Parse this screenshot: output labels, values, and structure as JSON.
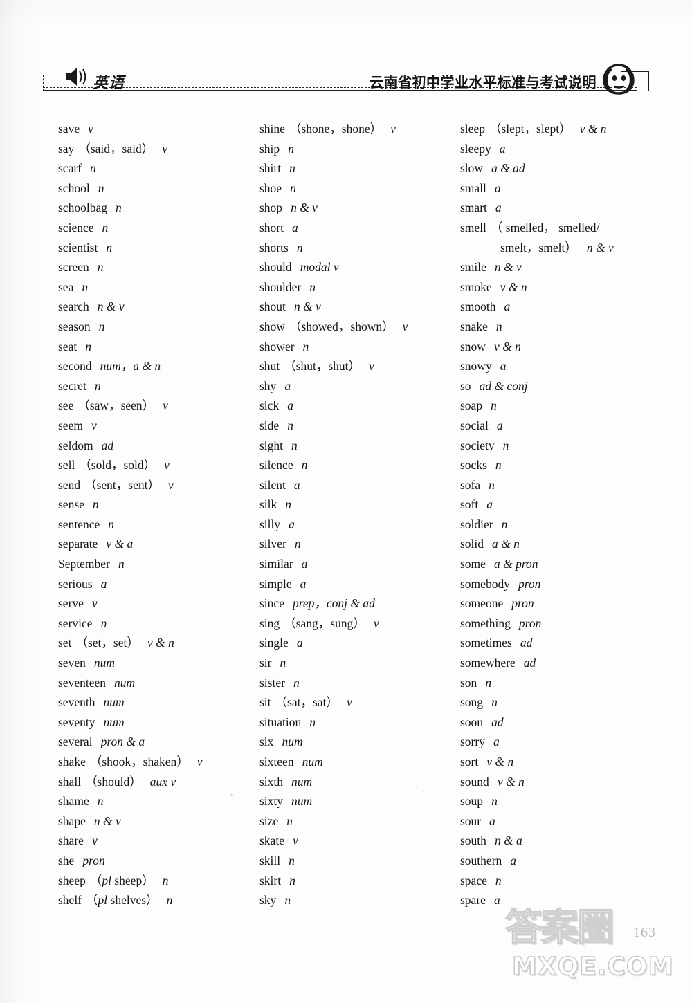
{
  "header": {
    "subject_label": "英语",
    "book_title": "云南省初中学业水平标准与考试说明",
    "speaker_icon": "speaker-icon",
    "headphone_icon": "headphone-face-icon"
  },
  "footer": {
    "page_number": "163",
    "watermark_cn": "答案圈",
    "watermark_en": "MXQE.COM"
  },
  "columns": [
    {
      "id": "column-1",
      "entries": [
        {
          "word": "save",
          "forms": "",
          "pos": "v"
        },
        {
          "word": "say",
          "forms": "（said，said）",
          "pos": "v"
        },
        {
          "word": "scarf",
          "forms": "",
          "pos": "n"
        },
        {
          "word": "school",
          "forms": "",
          "pos": "n"
        },
        {
          "word": "schoolbag",
          "forms": "",
          "pos": "n"
        },
        {
          "word": "science",
          "forms": "",
          "pos": "n"
        },
        {
          "word": "scientist",
          "forms": "",
          "pos": "n"
        },
        {
          "word": "screen",
          "forms": "",
          "pos": "n"
        },
        {
          "word": "sea",
          "forms": "",
          "pos": "n"
        },
        {
          "word": "search",
          "forms": "",
          "pos": "n & v"
        },
        {
          "word": "season",
          "forms": "",
          "pos": "n"
        },
        {
          "word": "seat",
          "forms": "",
          "pos": "n"
        },
        {
          "word": "second",
          "forms": "",
          "pos": "num，a & n"
        },
        {
          "word": "secret",
          "forms": "",
          "pos": "n"
        },
        {
          "word": "see",
          "forms": "（saw，seen）",
          "pos": "v"
        },
        {
          "word": "seem",
          "forms": "",
          "pos": "v"
        },
        {
          "word": "seldom",
          "forms": "",
          "pos": "ad"
        },
        {
          "word": "sell",
          "forms": "（sold，sold）",
          "pos": "v"
        },
        {
          "word": "send",
          "forms": "（sent，sent）",
          "pos": "v"
        },
        {
          "word": "sense",
          "forms": "",
          "pos": "n"
        },
        {
          "word": "sentence",
          "forms": "",
          "pos": "n"
        },
        {
          "word": "separate",
          "forms": "",
          "pos": "v & a"
        },
        {
          "word": "September",
          "forms": "",
          "pos": "n"
        },
        {
          "word": "serious",
          "forms": "",
          "pos": "a"
        },
        {
          "word": "serve",
          "forms": "",
          "pos": "v"
        },
        {
          "word": "service",
          "forms": "",
          "pos": "n"
        },
        {
          "word": "set",
          "forms": "（set，set）",
          "pos": "v & n"
        },
        {
          "word": "seven",
          "forms": "",
          "pos": "num"
        },
        {
          "word": "seventeen",
          "forms": "",
          "pos": "num"
        },
        {
          "word": "seventh",
          "forms": "",
          "pos": "num"
        },
        {
          "word": "seventy",
          "forms": "",
          "pos": "num"
        },
        {
          "word": "several",
          "forms": "",
          "pos": "pron & a"
        },
        {
          "word": "shake",
          "forms": "（shook，shaken）",
          "pos": "v"
        },
        {
          "word": "shall",
          "forms": "（should）",
          "pos": "aux v"
        },
        {
          "word": "shame",
          "forms": "",
          "pos": "n"
        },
        {
          "word": "shape",
          "forms": "",
          "pos": "n & v"
        },
        {
          "word": "share",
          "forms": "",
          "pos": "v"
        },
        {
          "word": "she",
          "forms": "",
          "pos": "pron"
        },
        {
          "word": "sheep",
          "forms": "（pl sheep）",
          "pos": "n",
          "forms_italic_lead": "pl"
        },
        {
          "word": "shelf",
          "forms": "（pl shelves）",
          "pos": "n",
          "forms_italic_lead": "pl"
        }
      ]
    },
    {
      "id": "column-2",
      "entries": [
        {
          "word": "shine",
          "forms": "（shone，shone）",
          "pos": "v"
        },
        {
          "word": "ship",
          "forms": "",
          "pos": "n"
        },
        {
          "word": "shirt",
          "forms": "",
          "pos": "n"
        },
        {
          "word": "shoe",
          "forms": "",
          "pos": "n"
        },
        {
          "word": "shop",
          "forms": "",
          "pos": "n & v"
        },
        {
          "word": "short",
          "forms": "",
          "pos": "a"
        },
        {
          "word": "shorts",
          "forms": "",
          "pos": "n"
        },
        {
          "word": "should",
          "forms": "",
          "pos": "modal v"
        },
        {
          "word": "shoulder",
          "forms": "",
          "pos": "n"
        },
        {
          "word": "shout",
          "forms": "",
          "pos": "n & v"
        },
        {
          "word": "show",
          "forms": "（showed，shown）",
          "pos": "v"
        },
        {
          "word": "shower",
          "forms": "",
          "pos": "n"
        },
        {
          "word": "shut",
          "forms": "（shut，shut）",
          "pos": "v"
        },
        {
          "word": "shy",
          "forms": "",
          "pos": "a"
        },
        {
          "word": "sick",
          "forms": "",
          "pos": "a"
        },
        {
          "word": "side",
          "forms": "",
          "pos": "n"
        },
        {
          "word": "sight",
          "forms": "",
          "pos": "n"
        },
        {
          "word": "silence",
          "forms": "",
          "pos": "n"
        },
        {
          "word": "silent",
          "forms": "",
          "pos": "a"
        },
        {
          "word": "silk",
          "forms": "",
          "pos": "n"
        },
        {
          "word": "silly",
          "forms": "",
          "pos": "a"
        },
        {
          "word": "silver",
          "forms": "",
          "pos": "n"
        },
        {
          "word": "similar",
          "forms": "",
          "pos": "a"
        },
        {
          "word": "simple",
          "forms": "",
          "pos": "a"
        },
        {
          "word": "since",
          "forms": "",
          "pos": "prep，conj & ad"
        },
        {
          "word": "sing",
          "forms": "（sang，sung）",
          "pos": "v"
        },
        {
          "word": "single",
          "forms": "",
          "pos": "a"
        },
        {
          "word": "sir",
          "forms": "",
          "pos": "n"
        },
        {
          "word": "sister",
          "forms": "",
          "pos": "n"
        },
        {
          "word": "sit",
          "forms": "（sat，sat）",
          "pos": "v"
        },
        {
          "word": "situation",
          "forms": "",
          "pos": "n"
        },
        {
          "word": "six",
          "forms": "",
          "pos": "num"
        },
        {
          "word": "sixteen",
          "forms": "",
          "pos": "num"
        },
        {
          "word": "sixth",
          "forms": "",
          "pos": "num"
        },
        {
          "word": "sixty",
          "forms": "",
          "pos": "num"
        },
        {
          "word": "size",
          "forms": "",
          "pos": "n"
        },
        {
          "word": "skate",
          "forms": "",
          "pos": "v"
        },
        {
          "word": "skill",
          "forms": "",
          "pos": "n"
        },
        {
          "word": "skirt",
          "forms": "",
          "pos": "n"
        },
        {
          "word": "sky",
          "forms": "",
          "pos": "n"
        }
      ]
    },
    {
      "id": "column-3",
      "entries": [
        {
          "word": "sleep",
          "forms": "（slept，slept）",
          "pos": "v & n"
        },
        {
          "word": "sleepy",
          "forms": "",
          "pos": "a"
        },
        {
          "word": "slow",
          "forms": "",
          "pos": "a & ad"
        },
        {
          "word": "small",
          "forms": "",
          "pos": "a"
        },
        {
          "word": "smart",
          "forms": "",
          "pos": "a"
        },
        {
          "word": "smell",
          "forms": "（ smelled， smelled/",
          "pos": "",
          "line2_forms": "smelt，smelt）",
          "line2_pos": "n & v"
        },
        {
          "word": "smile",
          "forms": "",
          "pos": "n & v"
        },
        {
          "word": "smoke",
          "forms": "",
          "pos": "v & n"
        },
        {
          "word": "smooth",
          "forms": "",
          "pos": "a"
        },
        {
          "word": "snake",
          "forms": "",
          "pos": "n"
        },
        {
          "word": "snow",
          "forms": "",
          "pos": "v & n"
        },
        {
          "word": "snowy",
          "forms": "",
          "pos": "a"
        },
        {
          "word": "so",
          "forms": "",
          "pos": "ad & conj"
        },
        {
          "word": "soap",
          "forms": "",
          "pos": "n"
        },
        {
          "word": "social",
          "forms": "",
          "pos": "a"
        },
        {
          "word": "society",
          "forms": "",
          "pos": "n"
        },
        {
          "word": "socks",
          "forms": "",
          "pos": "n"
        },
        {
          "word": "sofa",
          "forms": "",
          "pos": "n"
        },
        {
          "word": "soft",
          "forms": "",
          "pos": "a"
        },
        {
          "word": "soldier",
          "forms": "",
          "pos": "n"
        },
        {
          "word": "solid",
          "forms": "",
          "pos": "a & n"
        },
        {
          "word": "some",
          "forms": "",
          "pos": "a & pron"
        },
        {
          "word": "somebody",
          "forms": "",
          "pos": "pron"
        },
        {
          "word": "someone",
          "forms": "",
          "pos": "pron"
        },
        {
          "word": "something",
          "forms": "",
          "pos": "pron"
        },
        {
          "word": "sometimes",
          "forms": "",
          "pos": "ad"
        },
        {
          "word": "somewhere",
          "forms": "",
          "pos": "ad"
        },
        {
          "word": "son",
          "forms": "",
          "pos": "n"
        },
        {
          "word": "song",
          "forms": "",
          "pos": "n"
        },
        {
          "word": "soon",
          "forms": "",
          "pos": "ad"
        },
        {
          "word": "sorry",
          "forms": "",
          "pos": "a"
        },
        {
          "word": "sort",
          "forms": "",
          "pos": "v & n"
        },
        {
          "word": "sound",
          "forms": "",
          "pos": "v & n"
        },
        {
          "word": "soup",
          "forms": "",
          "pos": "n"
        },
        {
          "word": "sour",
          "forms": "",
          "pos": "a"
        },
        {
          "word": "south",
          "forms": "",
          "pos": "n & a"
        },
        {
          "word": "southern",
          "forms": "",
          "pos": "a"
        },
        {
          "word": "space",
          "forms": "",
          "pos": "n"
        },
        {
          "word": "spare",
          "forms": "",
          "pos": "a"
        }
      ]
    }
  ]
}
